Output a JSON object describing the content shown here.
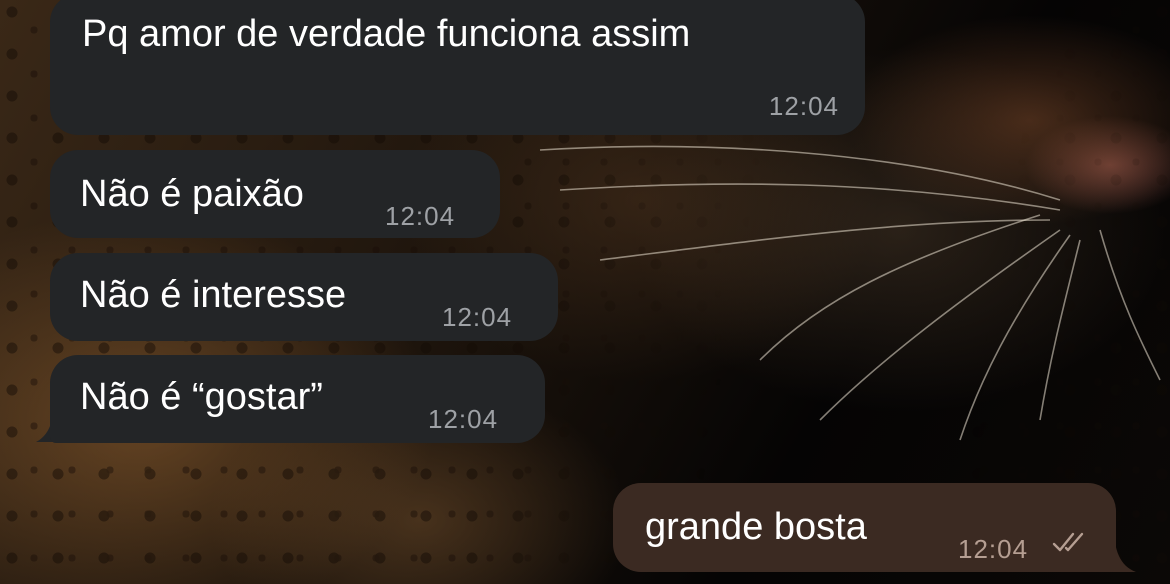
{
  "messages": [
    {
      "direction": "incoming",
      "text": "Pq amor de verdade funciona assim",
      "time": "12:04"
    },
    {
      "direction": "incoming",
      "text": "Não é paixão",
      "time": "12:04"
    },
    {
      "direction": "incoming",
      "text": "Não é interesse",
      "time": "12:04"
    },
    {
      "direction": "incoming",
      "text": "Não é “gostar”",
      "time": "12:04"
    },
    {
      "direction": "outgoing",
      "text": "grande bosta",
      "time": "12:04",
      "status": "read",
      "status_icon": "double-check-icon"
    }
  ],
  "colors": {
    "incoming_bubble": "#232527",
    "outgoing_bubble": "#3b2a22",
    "text": "#ffffff",
    "timestamp_incoming": "#9ea1a5",
    "timestamp_outgoing": "#b59e92"
  },
  "wallpaper": "leopard-photo"
}
